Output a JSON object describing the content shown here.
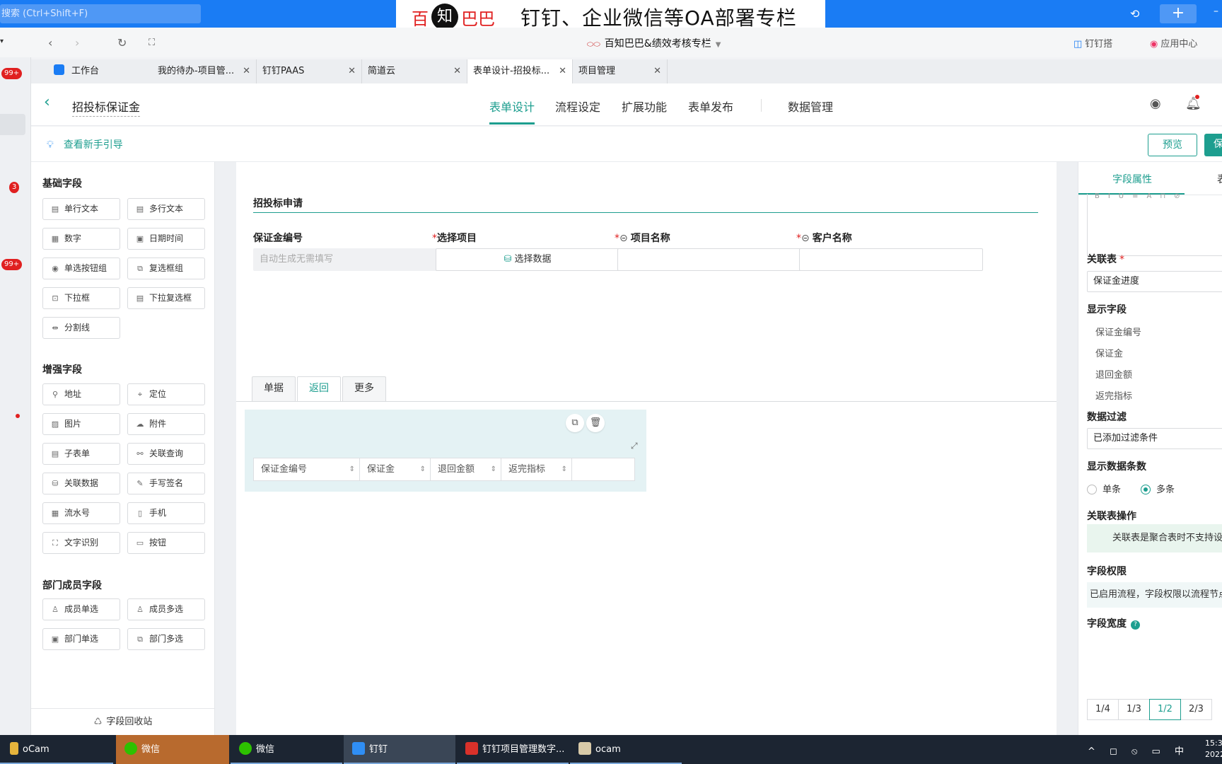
{
  "topbar": {
    "search_placeholder": "搜索 (Ctrl+Shift+F)",
    "banner_p1": "百",
    "banner_p2": "知",
    "banner_p3": "巴巴",
    "banner_text": "钉钉、企业微信等OA部署专栏",
    "plus": "+",
    "minimize": "–"
  },
  "browser": {
    "page_title": "百知巴巴&绩效考核专栏",
    "right1": "钉钉搭",
    "right2": "应用中心"
  },
  "tabs": [
    {
      "label": "工作台"
    },
    {
      "label": "我的待办-项目管..."
    },
    {
      "label": "钉钉PAAS"
    },
    {
      "label": "简道云"
    },
    {
      "label": "表单设计-招投标..."
    },
    {
      "label": "项目管理"
    }
  ],
  "leftstrip": {
    "badge1": "99+",
    "badge2": "3",
    "badge3": "99+"
  },
  "app": {
    "form_name": "招投标保证金",
    "nav": [
      "表单设计",
      "流程设定",
      "扩展功能",
      "表单发布",
      "数据管理"
    ],
    "guide": "查看新手引导",
    "preview": "预览",
    "save": "保"
  },
  "palette": {
    "basic_title": "基础字段",
    "basic": [
      "单行文本",
      "多行文本",
      "数字",
      "日期时间",
      "单选按钮组",
      "复选框组",
      "下拉框",
      "下拉复选框",
      "分割线"
    ],
    "enhanced_title": "增强字段",
    "enhanced": [
      "地址",
      "定位",
      "图片",
      "附件",
      "子表单",
      "关联查询",
      "关联数据",
      "手写签名",
      "流水号",
      "手机",
      "文字识别",
      "按钮"
    ],
    "dept_title": "部门成员字段",
    "dept": [
      "成员单选",
      "成员多选",
      "部门单选",
      "部门多选"
    ],
    "recycle": "字段回收站"
  },
  "form": {
    "section_title": "招投标申请",
    "fields": [
      {
        "label": "保证金编号",
        "required": false,
        "placeholder": "自动生成无需填写"
      },
      {
        "label": "选择项目",
        "required": true,
        "button": "选择数据"
      },
      {
        "label": "项目名称",
        "required": true
      },
      {
        "label": "客户名称",
        "required": true
      }
    ],
    "subtabs": [
      "单据",
      "返回",
      "更多"
    ],
    "subtable_cols": [
      "保证金编号",
      "保证金",
      "退回金额",
      "返完指标"
    ]
  },
  "rpanel": {
    "tab1": "字段属性",
    "tab2": "表",
    "link_table_label": "关联表",
    "link_table_value": "保证金进度",
    "display_fields_label": "显示字段",
    "display_fields": [
      "保证金编号",
      "保证金",
      "退回金额",
      "返完指标"
    ],
    "filter_label": "数据过滤",
    "filter_value": "已添加过滤条件",
    "count_label": "显示数据条数",
    "count_single": "单条",
    "count_multi": "多条",
    "ops_label": "关联表操作",
    "ops_note": "关联表是聚合表时不支持设",
    "perm_label": "字段权限",
    "perm_note": "已启用流程，字段权限以流程节点",
    "width_label": "字段宽度",
    "widths": [
      "1/4",
      "1/3",
      "1/2",
      "2/3"
    ],
    "width_selected": "1/2"
  },
  "taskbar": {
    "items": [
      "oCam",
      "微信",
      "微信",
      "钉钉",
      "钉钉项目管理数字...",
      "ocam"
    ],
    "tray": "^ ◻ ⦸ ▭ 中",
    "clock1": "15:3",
    "clock2": "2022"
  }
}
